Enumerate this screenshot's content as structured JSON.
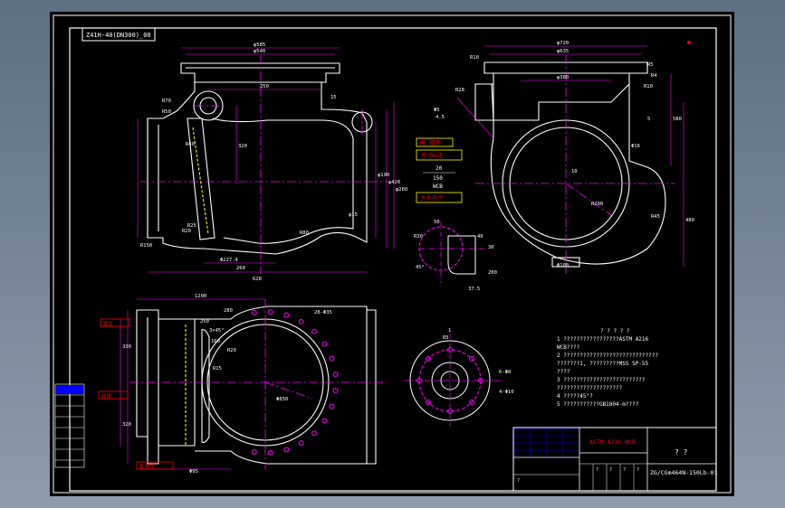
{
  "drawing_id": "Z41H-40(DN300)_00",
  "part_no": "ZG/CGm464N-150Lb-01",
  "material": "ASTM A216 WCB",
  "sheet_qmarks": "? ?",
  "top_view": {
    "dims_top": [
      "φ585",
      "φ540"
    ],
    "dims_side": [
      "250",
      "R70",
      "R50",
      "15",
      "320",
      "R40",
      "R25",
      "φ15",
      "φ190",
      "φ420",
      "φ260"
    ],
    "dims_bottom": [
      "R150",
      "R20",
      "R80",
      "Φ227.4",
      "260",
      "628"
    ]
  },
  "right_view": {
    "dims_top": [
      "φ720",
      "φ635",
      "φ380"
    ],
    "dims_side": [
      "R10",
      "R5",
      "R4",
      "R10",
      "R28",
      "Φ5",
      "4.5",
      "580",
      "480",
      "5",
      "Φ16",
      "10",
      "R200",
      "R45",
      "Φ100"
    ]
  },
  "center_tags": {
    "tag1": "阀门管件",
    "tag2": "尺寸标注",
    "frac_top": "20",
    "frac_mid": "150",
    "frac_bot": "WCB",
    "tag3": "外形尺寸"
  },
  "small_view": {
    "dims": [
      "50",
      "40",
      "R30",
      "30",
      "37.5",
      "200",
      "45°"
    ]
  },
  "bottom_view": {
    "dims": [
      "1200",
      "280",
      "250",
      "3×45°",
      "28-Φ35",
      "160",
      "R20",
      "Φ850",
      "R15",
      "330",
      "320",
      "Φ95"
    ],
    "tags": [
      "锻压",
      "阀体",
      "标准件"
    ]
  },
  "small_flange": {
    "dims": [
      "1",
      "R5",
      "6-Φ8",
      "4-Φ10"
    ]
  },
  "notes": {
    "title": "? ? ? ? ?",
    "lines": [
      "1   ?????????????????ASTM A216",
      "    WCB????",
      "2   ?????????????????????????????",
      "    ???????1, ?????????MSS SP-55",
      "    ????",
      "3   ?????????????????????????",
      "    ????????????????????",
      "4   ?????45°?",
      "5   ???????????GB1804-m????"
    ]
  },
  "title_block": {
    "table_cells": [
      "?",
      "?",
      "?",
      "?",
      "?"
    ]
  },
  "colors": {
    "frame": "#ffffff",
    "part": "#ffffff",
    "center": "#ff00ff",
    "dim": "#ff00ff",
    "dim_text": "#ffffff",
    "hidden": "#ffff00",
    "grid": "#0000ff",
    "tag": "#ff0000"
  }
}
